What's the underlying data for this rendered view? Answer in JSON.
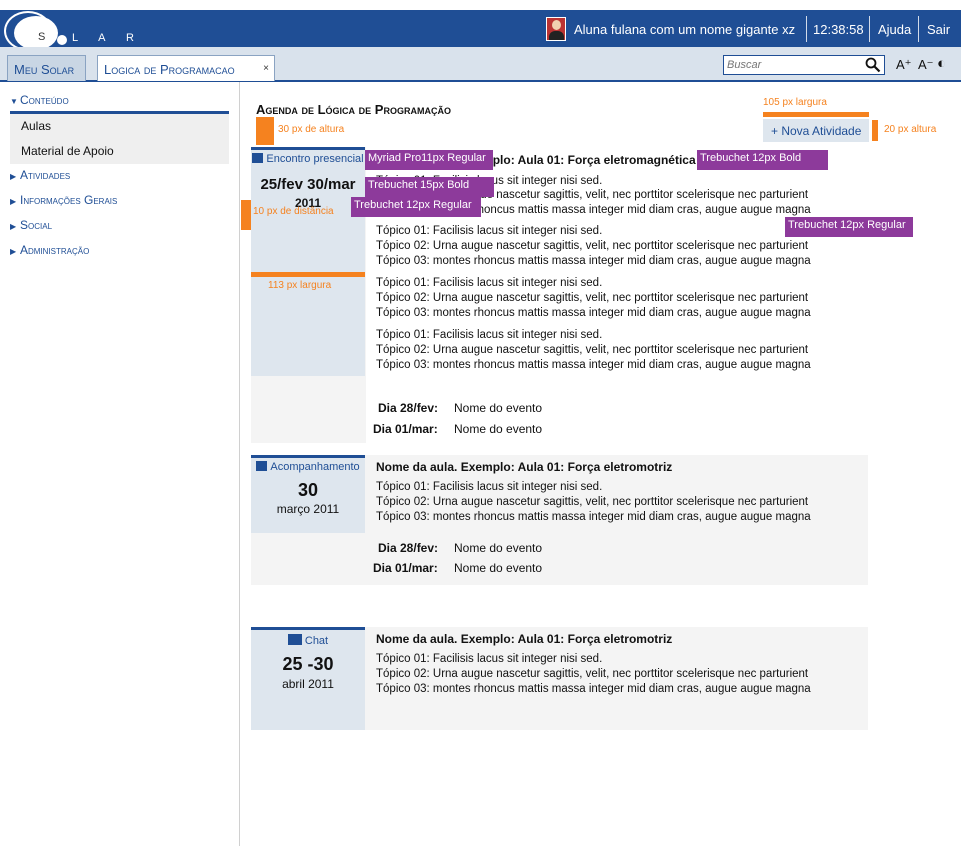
{
  "header": {
    "logo_text": "L A R",
    "logo_letter": "S",
    "user_name": "Aluna fulana com um nome gigante xz",
    "time": "12:38:58",
    "help": "Ajuda",
    "logout": "Sair"
  },
  "tabs": {
    "home": "Meu Solar",
    "course": "Logica de Programacao",
    "close": "×"
  },
  "search": {
    "placeholder": "Buscar"
  },
  "controls": {
    "font_up": "A⁺",
    "font_down": "A⁻",
    "contrast": "◐"
  },
  "sidebar": {
    "items": [
      "Conteúdo",
      "Atividades",
      "Informações Gerais",
      "Social",
      "Administração"
    ],
    "content_subitems": [
      "Aulas",
      "Material de Apoio"
    ]
  },
  "main": {
    "title": "Agenda de Lógica de Programação",
    "new_activity": "+ Nova Atividade"
  },
  "cards": [
    {
      "type": "Encontro presencial",
      "date": "25/fev 30/mar",
      "year": "2011",
      "title": "Nome da aula. Exemplo: Aula 01: Força eletromagnética",
      "topics": [
        "Tópico 01: Facilisis lacus sit integer nisi sed.",
        "Tópico 02: Urna augue nascetur sagittis, velit, nec porttitor scelerisque nec parturient",
        "Tópico 03: montes rhoncus mattis massa integer mid diam cras, augue augue magna"
      ],
      "events": [
        {
          "day": "Dia 28/fev:",
          "name": "Nome do evento"
        },
        {
          "day": "Dia 01/mar:",
          "name": "Nome do evento"
        }
      ]
    },
    {
      "type": "Acompanhamento",
      "date": "30",
      "month_year": "março 2011",
      "title": "Nome da aula. Exemplo: Aula 01: Força eletromotriz",
      "topics": [
        "Tópico 01: Facilisis lacus sit integer nisi sed.",
        "Tópico 02: Urna augue nascetur sagittis, velit, nec porttitor scelerisque nec parturient",
        "Tópico 03: montes rhoncus mattis massa integer mid diam cras, augue augue magna"
      ],
      "events": [
        {
          "day": "Dia 28/fev:",
          "name": "Nome do evento"
        },
        {
          "day": "Dia 01/mar:",
          "name": "Nome do evento"
        }
      ]
    },
    {
      "type": "Chat",
      "date": "25 -30",
      "month_year": "abril 2011",
      "title": "Nome da aula. Exemplo: Aula 01: Força eletromotriz",
      "topics": [
        "Tópico 01: Facilisis lacus sit integer nisi sed.",
        "Tópico 02: Urna augue nascetur sagittis, velit, nec porttitor scelerisque nec parturient",
        "Tópico 03: montes rhoncus mattis massa integer mid diam cras, augue augue magna"
      ]
    }
  ],
  "annotations": {
    "h30": "30 px de altura",
    "w105": "105 px largura",
    "h20": "20 px altura",
    "d10": "10 px de distância",
    "w113": "113 px largura",
    "myriad": "Myriad Pro11px Regular",
    "trebuchet_bold_12": "Trebuchet 12px Bold",
    "trebuchet_bold_15": "Trebuchet 15px Bold",
    "trebuchet_reg_12a": "Trebuchet 12px Regular",
    "trebuchet_reg_12b": "Trebuchet 12px Regular"
  },
  "colors": {
    "brand": "#1f4e95",
    "annotation_orange": "#f5821f",
    "annotation_purple": "#8d3a9b"
  }
}
